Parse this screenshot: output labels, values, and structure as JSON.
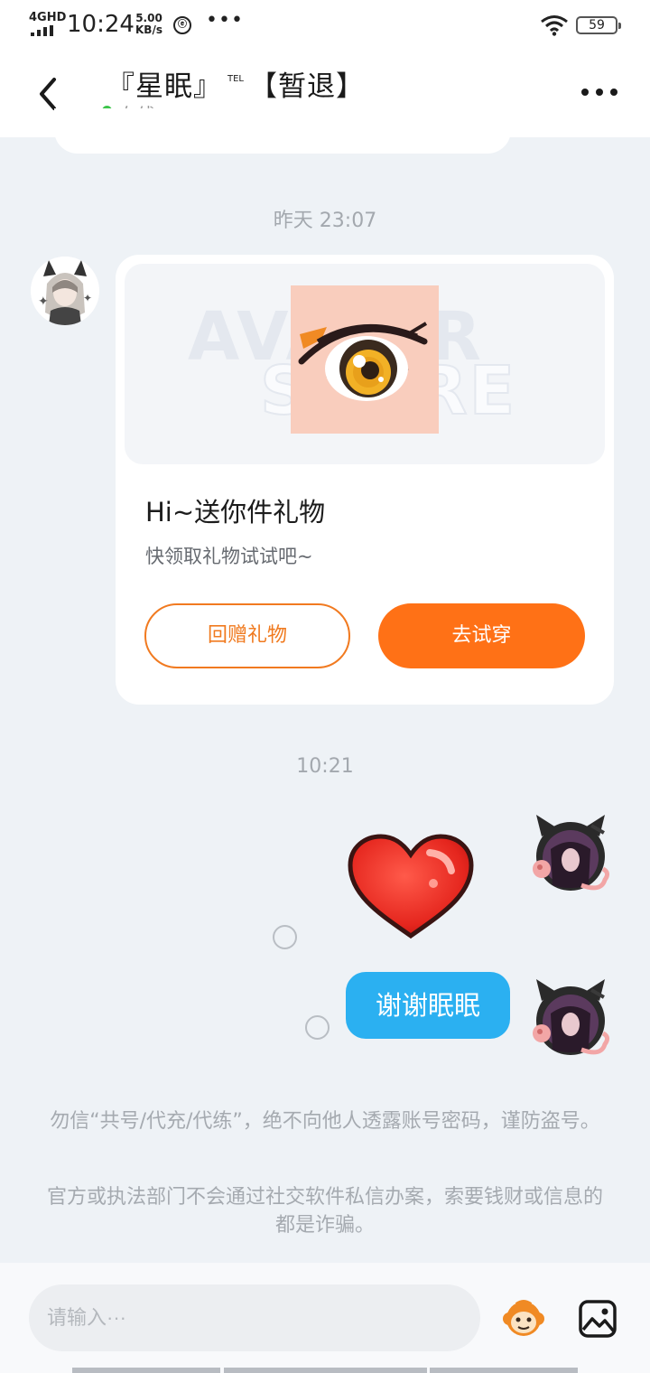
{
  "status_bar": {
    "network": "4GHD",
    "time": "10:24",
    "speed_value": "5.00",
    "speed_unit": "KB/s",
    "app_indicator": "ⓔ",
    "more": "•••",
    "battery": "59",
    "icons": [
      "signal-icon",
      "wifi-icon",
      "battery-icon"
    ]
  },
  "header": {
    "back_icon": "back-chevron-icon",
    "title_left": "『星眠』",
    "title_tel": "TEL",
    "title_right": "【暂退】",
    "status": "在线",
    "status_color": "#3cc54a",
    "more_icon": "more-dots-icon"
  },
  "chat": {
    "timestamp_1": "昨天 23:07",
    "timestamp_2": "10:21",
    "gift_card": {
      "watermark_line1": "AVATAR",
      "watermark_line2": "STORE",
      "title": "Hi~送你件礼物",
      "subtitle": "快领取礼物试试吧~",
      "return_gift_label": "回赠礼物",
      "try_on_label": "去试穿",
      "accent_color": "#ff7116"
    },
    "messages": [
      {
        "type": "sticker",
        "sticker": "red-heart",
        "from": "me"
      },
      {
        "type": "text",
        "text": "谢谢眠眠",
        "from": "me",
        "bubble_color": "#2bb0f1"
      }
    ]
  },
  "notices": [
    "勿信“共号/代充/代练”，绝不向他人透露账号密码，谨防盗号。",
    "官方或执法部门不会通过社交软件私信办案，索要钱财或信息的都是诈骗。"
  ],
  "input_bar": {
    "placeholder": "请输入···",
    "emoji_icon": "monkey-emoji-icon",
    "image_icon": "image-icon"
  }
}
